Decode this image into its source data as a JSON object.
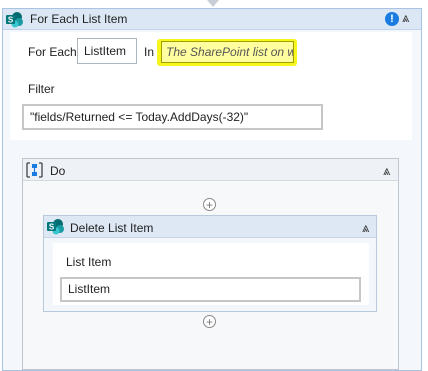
{
  "for_each": {
    "title": "For Each List Item",
    "info_icon": "info-icon",
    "collapse_glyph": "⩓",
    "for_each_label": "For Each",
    "item_variable": "ListItem",
    "in_label": "In",
    "list_placeholder": "The SharePoint list on w",
    "filter_label": "Filter",
    "filter_value": "\"fields/Returned  <= Today.AddDays(-32)\""
  },
  "do_block": {
    "label": "Do",
    "icon": "sequence-icon",
    "collapse_glyph": "⩓",
    "add_glyph": "+"
  },
  "delete_activity": {
    "title": "Delete List Item",
    "collapse_glyph": "⩓",
    "list_item_label": "List Item",
    "list_item_value": "ListItem",
    "add_glyph": "+"
  },
  "colors": {
    "header_bg": "#dbe7f4",
    "highlight": "#f6f61c",
    "sharepoint_teal": "#0f7b8a",
    "info_blue": "#1a7be0"
  }
}
